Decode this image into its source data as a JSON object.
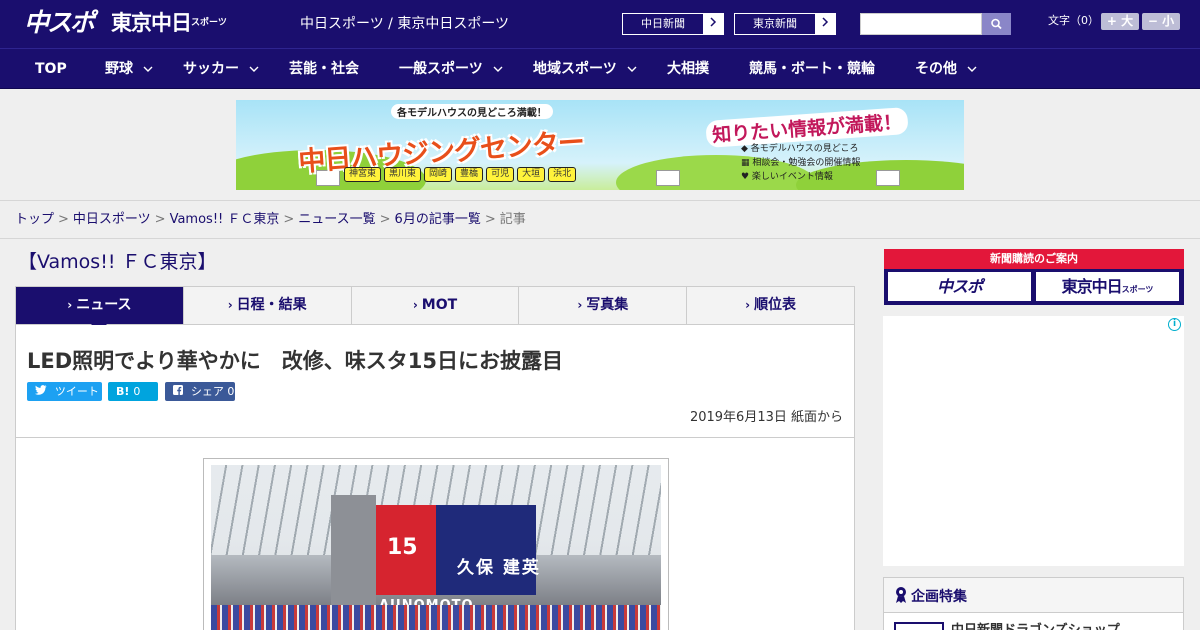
{
  "header": {
    "logo_chuspo": "中スポ",
    "logo_tokyo": "東京中日",
    "logo_tokyo_sub": "スポーツ",
    "site_name": "中日スポーツ / 東京中日スポーツ",
    "paper_links": [
      {
        "label": "中日新聞"
      },
      {
        "label": "東京新聞"
      }
    ],
    "font_size": {
      "label": "文字（0）",
      "plus": "+ 大",
      "minus": "− 小"
    }
  },
  "nav": {
    "items": [
      {
        "label": "TOP",
        "dropdown": false
      },
      {
        "label": "野球",
        "dropdown": true
      },
      {
        "label": "サッカー",
        "dropdown": true
      },
      {
        "label": "芸能・社会",
        "dropdown": false
      },
      {
        "label": "一般スポーツ",
        "dropdown": true
      },
      {
        "label": "地域スポーツ",
        "dropdown": true
      },
      {
        "label": "大相撲",
        "dropdown": false
      },
      {
        "label": "競馬・ボート・競輪",
        "dropdown": false
      },
      {
        "label": "その他",
        "dropdown": true
      }
    ]
  },
  "banner": {
    "top_text": "各モデルハウスの見どころ満載！",
    "title": "中日ハウジングセンター",
    "right_title": "知りたい情報が満載！",
    "info": [
      "◆ 各モデルハウスの見どころ",
      "▦ 相談会・勉強会の開催情報",
      "♥ 楽しいイベント情報"
    ],
    "cities": [
      "神宮東",
      "黒川東",
      "岡崎",
      "豊橋",
      "可児",
      "大垣",
      "浜北"
    ]
  },
  "breadcrumb": {
    "items": [
      "トップ",
      "中日スポーツ",
      "Vamos!! ＦＣ東京",
      "ニュース一覧",
      "6月の記事一覧"
    ],
    "current": "記事",
    "separator": ">"
  },
  "section": {
    "title": "【Vamos!! ＦＣ東京】"
  },
  "tabs": [
    {
      "label": "ニュース",
      "active": true
    },
    {
      "label": "日程・結果",
      "active": false
    },
    {
      "label": "MOT",
      "active": false
    },
    {
      "label": "写真集",
      "active": false
    },
    {
      "label": "順位表",
      "active": false
    }
  ],
  "article": {
    "headline": "LED照明でより華やかに　改修、味スタ15日にお披露目",
    "share": {
      "tweet": "ツイート",
      "hatena_icon": "B!",
      "hatena_count": "0",
      "facebook": "シェア 0"
    },
    "date": "2019年6月13日 紙面から",
    "photo": {
      "screen_number": "15",
      "screen_name": "久保 建英",
      "sign_text": "AJINOMOTO"
    }
  },
  "sidebar": {
    "subscription": {
      "title": "新聞購読のご案内",
      "chuspo": "中スポ",
      "tokyo": "東京中日",
      "tokyo_sub": "スポーツ"
    },
    "ad_info": "i",
    "feature": {
      "title": "企画特集",
      "item": "中日新聞ドラゴンズショップ"
    }
  },
  "icons": {
    "paper_arrow": "chevron-right-icon",
    "search": "search-icon",
    "nav_dropdown": "chevron-down-icon",
    "tab_arrow": "chevron-right-icon",
    "twitter": "twitter-icon",
    "facebook": "facebook-icon",
    "feature": "ribbon-icon"
  },
  "colors": {
    "brand": "#1a0e6e",
    "accent_red": "#e3173a",
    "twitter": "#1da1f2",
    "hatena": "#00a4de",
    "facebook": "#3b5998"
  }
}
